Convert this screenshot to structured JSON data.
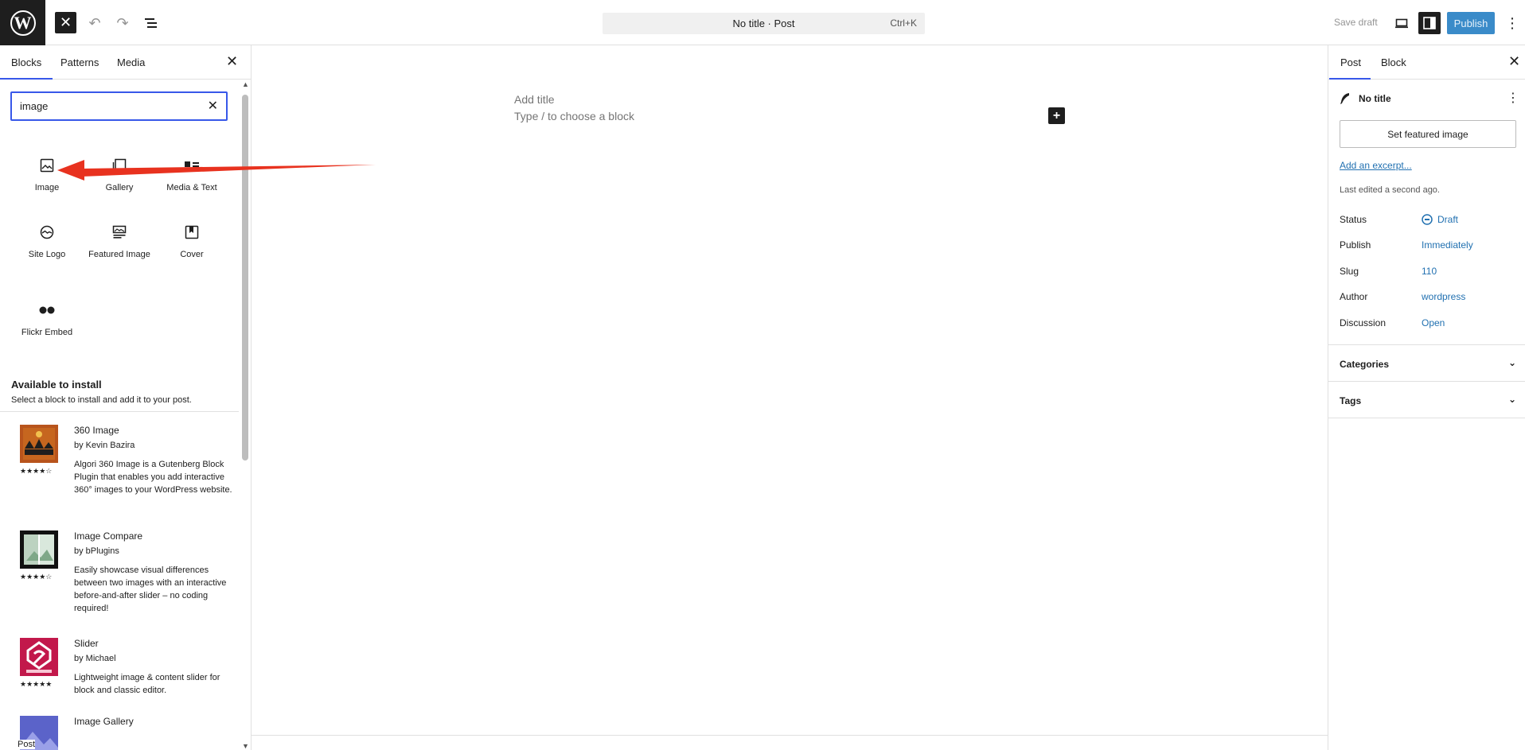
{
  "topbar": {
    "logo_letter": "W",
    "command_title": "No title · Post",
    "command_shortcut": "Ctrl+K",
    "save_draft": "Save draft",
    "publish": "Publish"
  },
  "inserter": {
    "tabs": [
      "Blocks",
      "Patterns",
      "Media"
    ],
    "search_value": "image",
    "blocks": [
      {
        "label": "Image",
        "icon": "image-icon"
      },
      {
        "label": "Gallery",
        "icon": "gallery-icon"
      },
      {
        "label": "Media & Text",
        "icon": "media-text-icon"
      },
      {
        "label": "Site Logo",
        "icon": "site-logo-icon"
      },
      {
        "label": "Featured Image",
        "icon": "featured-image-icon"
      },
      {
        "label": "Cover",
        "icon": "cover-icon"
      },
      {
        "label": "Flickr Embed",
        "icon": "flickr-icon"
      }
    ],
    "available_title": "Available to install",
    "available_subtitle": "Select a block to install and add it to your post.",
    "plugins": [
      {
        "name": "360 Image",
        "author": "by Kevin Bazira",
        "description": "Algori 360 Image is a Gutenberg Block Plugin that enables you add interactive 360° images to your WordPress website.",
        "stars": "★★★★☆"
      },
      {
        "name": "Image Compare",
        "author": "by bPlugins",
        "description": "Easily showcase visual differences between two images with an interactive before-and-after slider – no coding required!",
        "stars": "★★★★☆"
      },
      {
        "name": "Slider",
        "author": "by Michael",
        "description": "Lightweight image & content slider for block and classic editor.",
        "stars": "★★★★★"
      },
      {
        "name": "Image Gallery",
        "author": "",
        "description": "",
        "stars": ""
      }
    ],
    "footer_crumb": "Post"
  },
  "canvas": {
    "title_placeholder": "Add title",
    "block_placeholder": "Type / to choose a block"
  },
  "sidebar": {
    "tabs": [
      "Post",
      "Block"
    ],
    "post_title": "No title",
    "featured_button": "Set featured image",
    "excerpt_link": "Add an excerpt...",
    "last_edited": "Last edited a second ago.",
    "meta": [
      {
        "label": "Status",
        "value": "Draft"
      },
      {
        "label": "Publish",
        "value": "Immediately"
      },
      {
        "label": "Slug",
        "value": "110"
      },
      {
        "label": "Author",
        "value": "wordpress"
      },
      {
        "label": "Discussion",
        "value": "Open"
      }
    ],
    "panels": [
      "Categories",
      "Tags"
    ]
  },
  "colors": {
    "accent": "#3858e9",
    "link": "#2271b1",
    "publish": "#3a8bc9",
    "annotation_arrow": "#e8321f"
  }
}
